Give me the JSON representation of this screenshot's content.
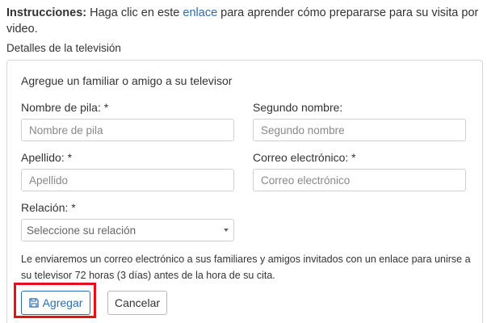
{
  "instructions": {
    "prefix": "Instrucciones:",
    "before_link": " Haga clic en este ",
    "link": "enlace",
    "after_link": " para aprender cómo prepararse para su visita por video."
  },
  "section_heading": "Detalles de la televisión",
  "form": {
    "title": "Agregue un familiar o amigo a su televisor",
    "first_name": {
      "label": "Nombre de pila: *",
      "placeholder": "Nombre de pila",
      "value": ""
    },
    "middle_name": {
      "label": "Segundo nombre:",
      "placeholder": "Segundo nombre",
      "value": ""
    },
    "last_name": {
      "label": "Apellido: *",
      "placeholder": "Apellido",
      "value": ""
    },
    "email": {
      "label": "Correo electrónico: *",
      "placeholder": "Correo electrónico",
      "value": ""
    },
    "relationship": {
      "label": "Relación: *",
      "selected": "Seleccione su relación"
    },
    "notice": "Le enviaremos un correo electrónico a sus familiares y amigos invitados con un enlace para unirse a su televisor 72 horas (3 días) antes de la hora de su cita.",
    "add_label": "Agregar",
    "cancel_label": "Cancelar"
  },
  "icons": {
    "add_button_icon": "floppy-disk-icon",
    "select_caret": "caret-down-icon"
  },
  "colors": {
    "accent": "#2a6db5",
    "highlight": "#e3121a",
    "border": "#d6d6d6"
  }
}
